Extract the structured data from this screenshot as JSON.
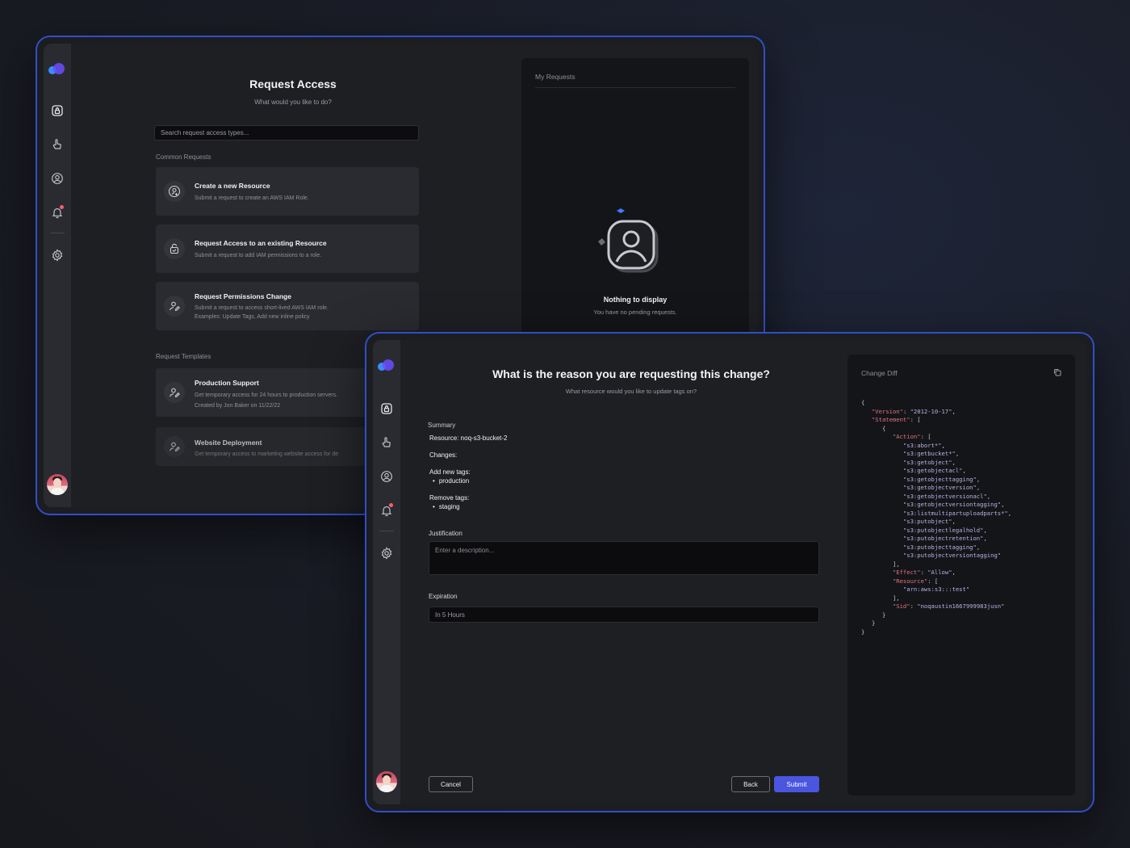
{
  "colors": {
    "accent": "#4a55e0",
    "frame_border": "#2f4fc7",
    "notification_dot": "#ff5a6a",
    "code_key": "#e2747f",
    "code_string": "#b9b3e8"
  },
  "sidebar_icons": [
    "logo",
    "lock-icon",
    "hand-pointer-icon",
    "user-circle-icon",
    "bell-icon",
    "gear-icon",
    "avatar"
  ],
  "request_access": {
    "title": "Request Access",
    "subtitle": "What would you like to do?",
    "search_placeholder": "Search request access types...",
    "common_label": "Common Requests",
    "common": [
      {
        "title": "Create a new Resource",
        "desc": "Submit a request to create an AWS IAM Role.",
        "desc2": ""
      },
      {
        "title": "Request Access to an existing Resource",
        "desc": "Submit a request to add IAM permissions to a role.",
        "desc2": ""
      },
      {
        "title": "Request Permissions Change",
        "desc": "Submit a request to access short-lived AWS IAM role.",
        "desc2": "Examples: Update Tags, Add new inline policy"
      }
    ],
    "templates_label": "Request Templates",
    "templates": [
      {
        "title": "Production Support",
        "desc": "Get temporary access for 24 hours to production servers.",
        "desc2": "Created by Jon Baker on 11/22/22"
      },
      {
        "title": "Website Deployment",
        "desc": "Get temporary access to marketing website access for de",
        "desc2": ""
      }
    ]
  },
  "my_requests": {
    "title": "My Requests",
    "empty_title": "Nothing to display",
    "empty_sub": "You have no pending requests."
  },
  "change_request": {
    "title": "What is the reason you are requesting this change?",
    "subtitle": "What resource would you like to update tags on?",
    "summary_label": "Summary",
    "resource": "Resource: noq-s3-bucket-2",
    "changes_label": "Changes:",
    "add_tags_label": "Add new tags:",
    "add_tags": [
      "production"
    ],
    "remove_tags_label": "Remove tags:",
    "remove_tags": [
      "staging"
    ],
    "justification_label": "Justification",
    "justification_placeholder": "Enter a description...",
    "expiration_label": "Expiration",
    "expiration_value": "In 5 Hours",
    "cancel": "Cancel",
    "back": "Back",
    "submit": "Submit"
  },
  "change_diff": {
    "title": "Change Diff",
    "version_key": "\"Version\"",
    "version_value": "\"2012-10-17\"",
    "statement_key": "\"Statement\"",
    "action_key": "\"Action\"",
    "actions": [
      "\"s3:abort*\"",
      "\"s3:getbucket*\"",
      "\"s3:getobject\"",
      "\"s3:getobjectacl\"",
      "\"s3:getobjecttagging\"",
      "\"s3:getobjectversion\"",
      "\"s3:getobjectversionacl\"",
      "\"s3:getobjectversiontagging\"",
      "\"s3:listmultipartuploadparts*\"",
      "\"s3:putobject\"",
      "\"s3:putobjectlegalhold\"",
      "\"s3:putobjectretention\"",
      "\"s3:putobjecttagging\"",
      "\"s3:putobjectversiontagging\""
    ],
    "effect_key": "\"Effect\"",
    "effect_value": "\"Allow\"",
    "resource_key": "\"Resource\"",
    "resources": [
      "\"arn:aws:s3:::test\""
    ],
    "sid_key": "\"Sid\"",
    "sid_value": "\"noqaustin1667999983jusn\""
  }
}
